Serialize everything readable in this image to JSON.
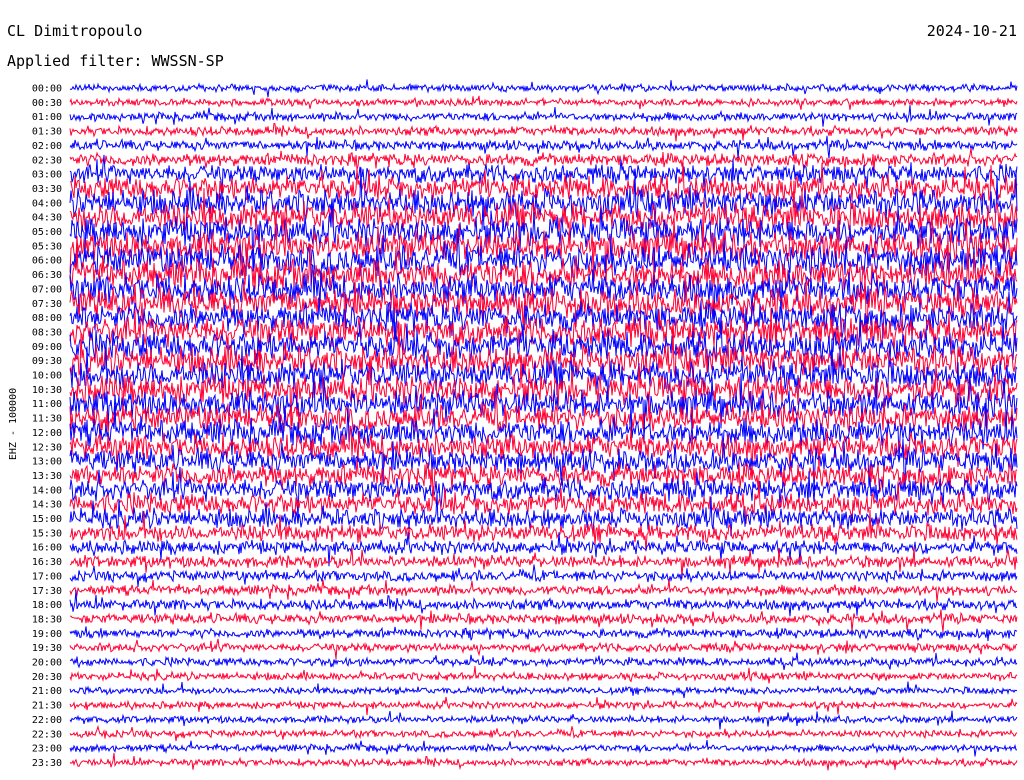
{
  "header": {
    "station": "CL Dimitropoulo",
    "filter": "Applied filter: WWSSN-SP",
    "date": "2024-10-21"
  },
  "chart_data": {
    "type": "line",
    "ylabel": "EHZ - 100000",
    "row_interval_minutes": 30,
    "row_labels": [
      "00:00",
      "00:30",
      "01:00",
      "01:30",
      "02:00",
      "02:30",
      "03:00",
      "03:30",
      "04:00",
      "04:30",
      "05:00",
      "05:30",
      "06:00",
      "06:30",
      "07:00",
      "07:30",
      "08:00",
      "08:30",
      "09:00",
      "09:30",
      "10:00",
      "10:30",
      "11:00",
      "11:30",
      "12:00",
      "12:30",
      "13:00",
      "13:30",
      "14:00",
      "14:30",
      "15:00",
      "15:30",
      "16:00",
      "16:30",
      "17:00",
      "17:30",
      "18:00",
      "18:30",
      "19:00",
      "19:30",
      "20:00",
      "20:30",
      "21:00",
      "21:30",
      "22:00",
      "22:30",
      "23:00",
      "23:30"
    ],
    "trace_colors": [
      "#0000ff",
      "#ff0033"
    ],
    "relative_amplitude": [
      1.0,
      1.0,
      1.2,
      1.3,
      1.4,
      1.8,
      2.6,
      3.4,
      3.8,
      4.0,
      4.0,
      4.1,
      4.2,
      4.2,
      4.1,
      4.0,
      4.0,
      4.0,
      4.1,
      4.1,
      4.0,
      4.0,
      3.8,
      3.6,
      3.6,
      3.5,
      3.3,
      3.2,
      3.1,
      3.0,
      2.8,
      2.5,
      1.9,
      1.7,
      1.5,
      1.4,
      1.5,
      1.4,
      1.3,
      1.2,
      1.2,
      1.1,
      1.0,
      1.0,
      1.0,
      1.0,
      1.0,
      1.0
    ]
  }
}
